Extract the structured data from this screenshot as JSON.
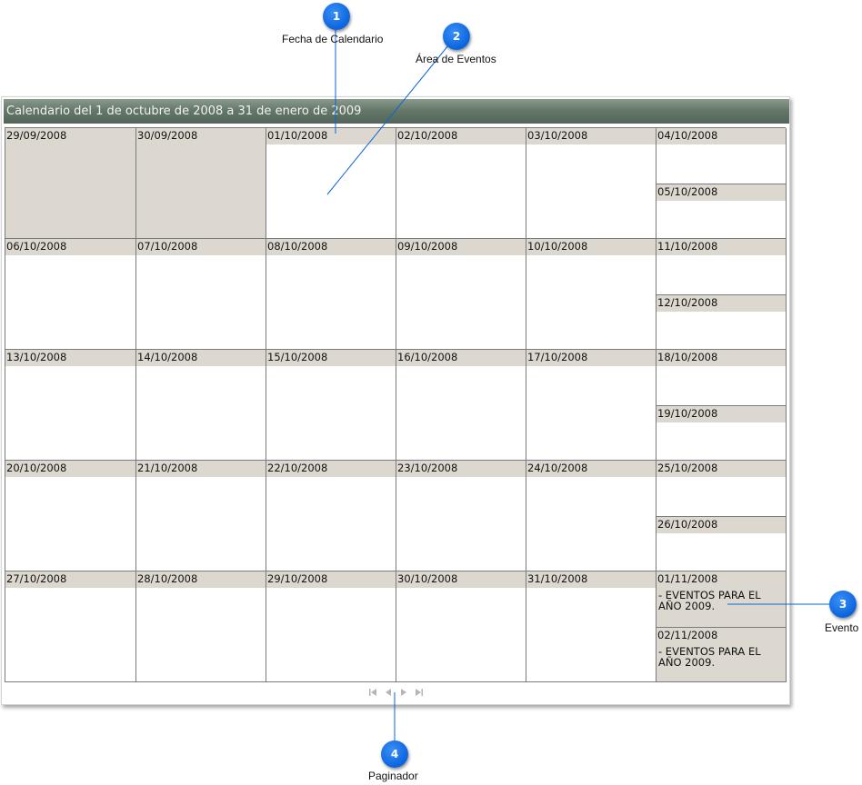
{
  "calendar": {
    "title": "Calendario del 1 de octubre de 2008 a 31 de enero de 2009",
    "weeks": [
      {
        "days": [
          {
            "date": "29/09/2008",
            "out": true
          },
          {
            "date": "30/09/2008",
            "out": true
          },
          {
            "date": "01/10/2008"
          },
          {
            "date": "02/10/2008"
          },
          {
            "date": "03/10/2008"
          }
        ],
        "weekend": [
          {
            "date": "04/10/2008",
            "event": ""
          },
          {
            "date": "05/10/2008",
            "event": ""
          }
        ]
      },
      {
        "days": [
          {
            "date": "06/10/2008"
          },
          {
            "date": "07/10/2008"
          },
          {
            "date": "08/10/2008"
          },
          {
            "date": "09/10/2008"
          },
          {
            "date": "10/10/2008"
          }
        ],
        "weekend": [
          {
            "date": "11/10/2008",
            "event": ""
          },
          {
            "date": "12/10/2008",
            "event": ""
          }
        ]
      },
      {
        "days": [
          {
            "date": "13/10/2008"
          },
          {
            "date": "14/10/2008"
          },
          {
            "date": "15/10/2008"
          },
          {
            "date": "16/10/2008"
          },
          {
            "date": "17/10/2008"
          }
        ],
        "weekend": [
          {
            "date": "18/10/2008",
            "event": ""
          },
          {
            "date": "19/10/2008",
            "event": ""
          }
        ]
      },
      {
        "days": [
          {
            "date": "20/10/2008"
          },
          {
            "date": "21/10/2008"
          },
          {
            "date": "22/10/2008"
          },
          {
            "date": "23/10/2008"
          },
          {
            "date": "24/10/2008"
          }
        ],
        "weekend": [
          {
            "date": "25/10/2008",
            "event": ""
          },
          {
            "date": "26/10/2008",
            "event": ""
          }
        ]
      },
      {
        "days": [
          {
            "date": "27/10/2008"
          },
          {
            "date": "28/10/2008"
          },
          {
            "date": "29/10/2008"
          },
          {
            "date": "30/10/2008"
          },
          {
            "date": "31/10/2008"
          }
        ],
        "weekend": [
          {
            "date": "01/11/2008",
            "event": "- EVENTOS PARA EL AÑO 2009."
          },
          {
            "date": "02/11/2008",
            "event": "- EVENTOS PARA EL AÑO 2009."
          }
        ]
      }
    ],
    "pager": [
      "first-page-icon",
      "previous-page-icon",
      "next-page-icon",
      "last-page-icon"
    ]
  },
  "callouts": [
    {
      "number": "1",
      "label": "Fecha de Calendario"
    },
    {
      "number": "2",
      "label": "Área de Eventos"
    },
    {
      "number": "3",
      "label": "Evento"
    },
    {
      "number": "4",
      "label": "Paginador"
    }
  ],
  "colors": {
    "header": "#65786a",
    "date_bar": "#dcd8d0",
    "callout": "#0a64dd",
    "grid_line": "#7b7b7b"
  }
}
